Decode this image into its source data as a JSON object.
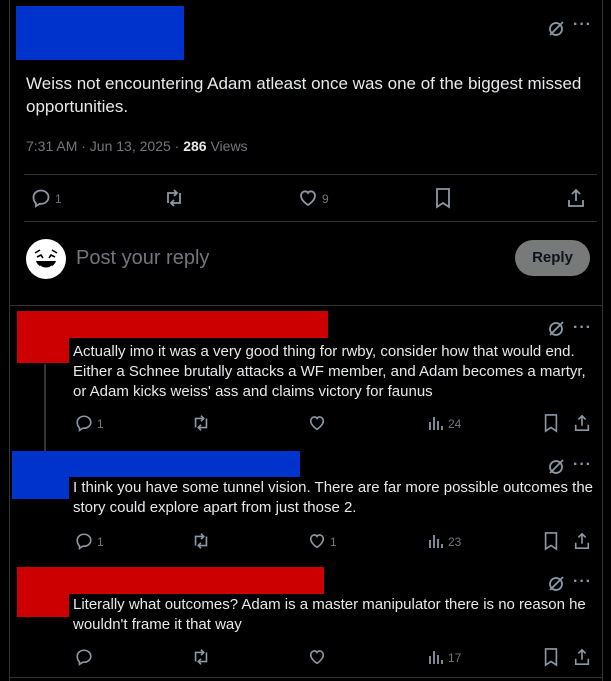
{
  "main_post": {
    "text": "Weiss not encountering Adam atleast once was one of the biggest missed opportunities.",
    "time": "7:31 AM · Jun 13, 2025 · ",
    "views_count": "286",
    "views_label": " Views",
    "reply_count": "1",
    "repost_count": "",
    "like_count": "9",
    "redaction_color": "#0033cc"
  },
  "composer": {
    "placeholder": "Post your reply",
    "reply_button": "Reply"
  },
  "replies": [
    {
      "redaction_color": "#cc0000",
      "text": "Actually imo it was a very good thing for rwby, consider how that would end. Either a Schnee brutally attacks a WF member, and Adam becomes a martyr, or Adam kicks weiss' ass and claims victory for faunus",
      "reply_count": "1",
      "like_count": "",
      "views": "24"
    },
    {
      "redaction_color": "#0033cc",
      "text": "I think you have some tunnel vision. There are far more possible outcomes the story could explore apart from just those 2.",
      "reply_count": "1",
      "like_count": "1",
      "views": "23"
    },
    {
      "redaction_color": "#cc0000",
      "text": "Literally what outcomes? Adam is a master manipulator there is no reason he wouldn't frame it that way",
      "reply_count": "",
      "like_count": "",
      "views": "17"
    }
  ],
  "icons": {
    "grok": "grok-icon",
    "more": "more-icon",
    "reply": "reply-icon",
    "repost": "repost-icon",
    "like": "heart-icon",
    "bookmark": "bookmark-icon",
    "share": "share-icon",
    "views": "views-icon"
  },
  "more_glyph": "···"
}
